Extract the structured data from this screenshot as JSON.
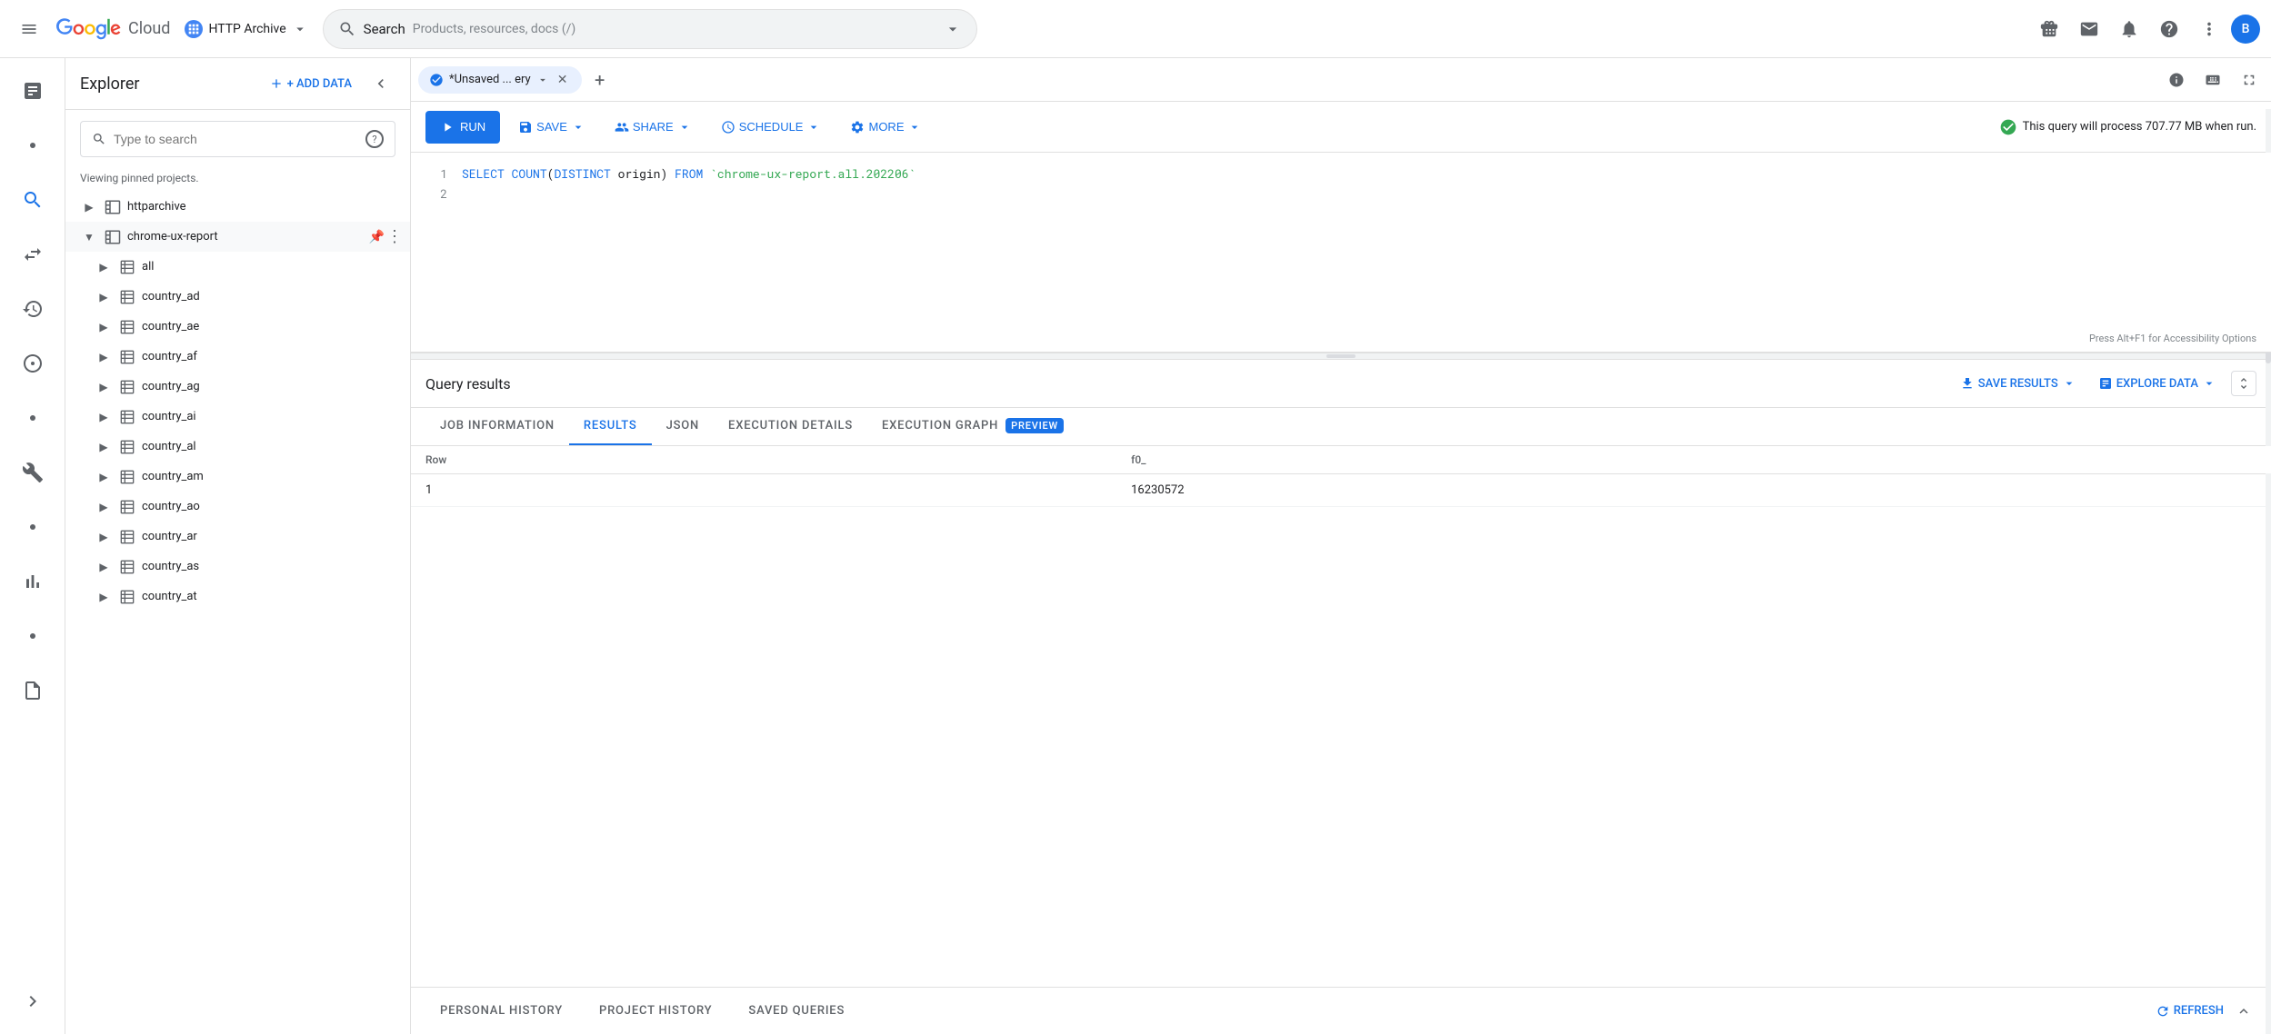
{
  "topnav": {
    "hamburger_label": "☰",
    "logo_letters": [
      "G",
      "o",
      "o",
      "g",
      "l",
      "e"
    ],
    "cloud_text": "Cloud",
    "project_name": "HTTP Archive",
    "search_label": "Search",
    "search_placeholder": "Products, resources, docs (/)",
    "nav_icons": [
      "gift",
      "mail",
      "bell",
      "help",
      "dots-vertical"
    ],
    "avatar_letter": "B"
  },
  "sidebar": {
    "items": [
      {
        "icon": "•",
        "label": ""
      },
      {
        "icon": "search",
        "label": "Search",
        "active": true
      },
      {
        "icon": "transfer",
        "label": "Transfer"
      },
      {
        "icon": "clock",
        "label": "History"
      },
      {
        "icon": "schema",
        "label": "Schema"
      },
      {
        "icon": "•",
        "label": ""
      },
      {
        "icon": "wrench",
        "label": "Tools"
      },
      {
        "icon": "•",
        "label": ""
      },
      {
        "icon": "chart",
        "label": "Chart"
      },
      {
        "icon": "•",
        "label": ""
      },
      {
        "icon": "doc",
        "label": "Docs"
      },
      {
        "icon": "expand",
        "label": "Expand",
        "bottom": true
      }
    ]
  },
  "explorer": {
    "title": "Explorer",
    "add_data_label": "+ ADD DATA",
    "search_placeholder": "Type to search",
    "viewing_text": "Viewing pinned projects.",
    "tree_items": [
      {
        "id": "httparchive",
        "label": "httparchive",
        "level": 0,
        "expanded": false,
        "has_arrow": true
      },
      {
        "id": "chrome-ux-report",
        "label": "chrome-ux-report",
        "level": 0,
        "expanded": true,
        "has_arrow": true,
        "pinned": true
      },
      {
        "id": "all",
        "label": "all",
        "level": 1,
        "expanded": false,
        "has_arrow": true
      },
      {
        "id": "country_ad",
        "label": "country_ad",
        "level": 1,
        "expanded": false,
        "has_arrow": true
      },
      {
        "id": "country_ae",
        "label": "country_ae",
        "level": 1,
        "expanded": false,
        "has_arrow": true
      },
      {
        "id": "country_af",
        "label": "country_af",
        "level": 1,
        "expanded": false,
        "has_arrow": true
      },
      {
        "id": "country_ag",
        "label": "country_ag",
        "level": 1,
        "expanded": false,
        "has_arrow": true
      },
      {
        "id": "country_ai",
        "label": "country_ai",
        "level": 1,
        "expanded": false,
        "has_arrow": true
      },
      {
        "id": "country_al",
        "label": "country_al",
        "level": 1,
        "expanded": false,
        "has_arrow": true
      },
      {
        "id": "country_am",
        "label": "country_am",
        "level": 1,
        "expanded": false,
        "has_arrow": true
      },
      {
        "id": "country_ao",
        "label": "country_ao",
        "level": 1,
        "expanded": false,
        "has_arrow": true
      },
      {
        "id": "country_ar",
        "label": "country_ar",
        "level": 1,
        "expanded": false,
        "has_arrow": true
      },
      {
        "id": "country_as",
        "label": "country_as",
        "level": 1,
        "expanded": false,
        "has_arrow": true
      },
      {
        "id": "country_at",
        "label": "country_at",
        "level": 1,
        "expanded": false,
        "has_arrow": true
      }
    ]
  },
  "query_editor": {
    "tab_label": "*Unsaved ... ery",
    "code_line1": "SELECT COUNT(DISTINCT origin) FROM `chrome-ux-report.all.202206`",
    "code_line2": "",
    "accessibility_hint": "Press Alt+F1 for Accessibility Options",
    "run_label": "RUN",
    "save_label": "SAVE",
    "share_label": "SHARE",
    "schedule_label": "SCHEDULE",
    "more_label": "MORE",
    "info_text": "This query will process 707.77 MB when run."
  },
  "results": {
    "title": "Query results",
    "save_results_label": "SAVE RESULTS",
    "explore_data_label": "EXPLORE DATA",
    "tabs": [
      {
        "id": "job_info",
        "label": "JOB INFORMATION",
        "active": false
      },
      {
        "id": "results",
        "label": "RESULTS",
        "active": true
      },
      {
        "id": "json",
        "label": "JSON",
        "active": false
      },
      {
        "id": "exec_details",
        "label": "EXECUTION DETAILS",
        "active": false
      },
      {
        "id": "exec_graph",
        "label": "EXECUTION GRAPH",
        "active": false,
        "preview": true
      }
    ],
    "table": {
      "columns": [
        "Row",
        "f0_"
      ],
      "rows": [
        {
          "row": "1",
          "value": "16230572"
        }
      ]
    }
  },
  "bottom_bar": {
    "tabs": [
      "PERSONAL HISTORY",
      "PROJECT HISTORY",
      "SAVED QUERIES"
    ],
    "refresh_label": "REFRESH"
  }
}
